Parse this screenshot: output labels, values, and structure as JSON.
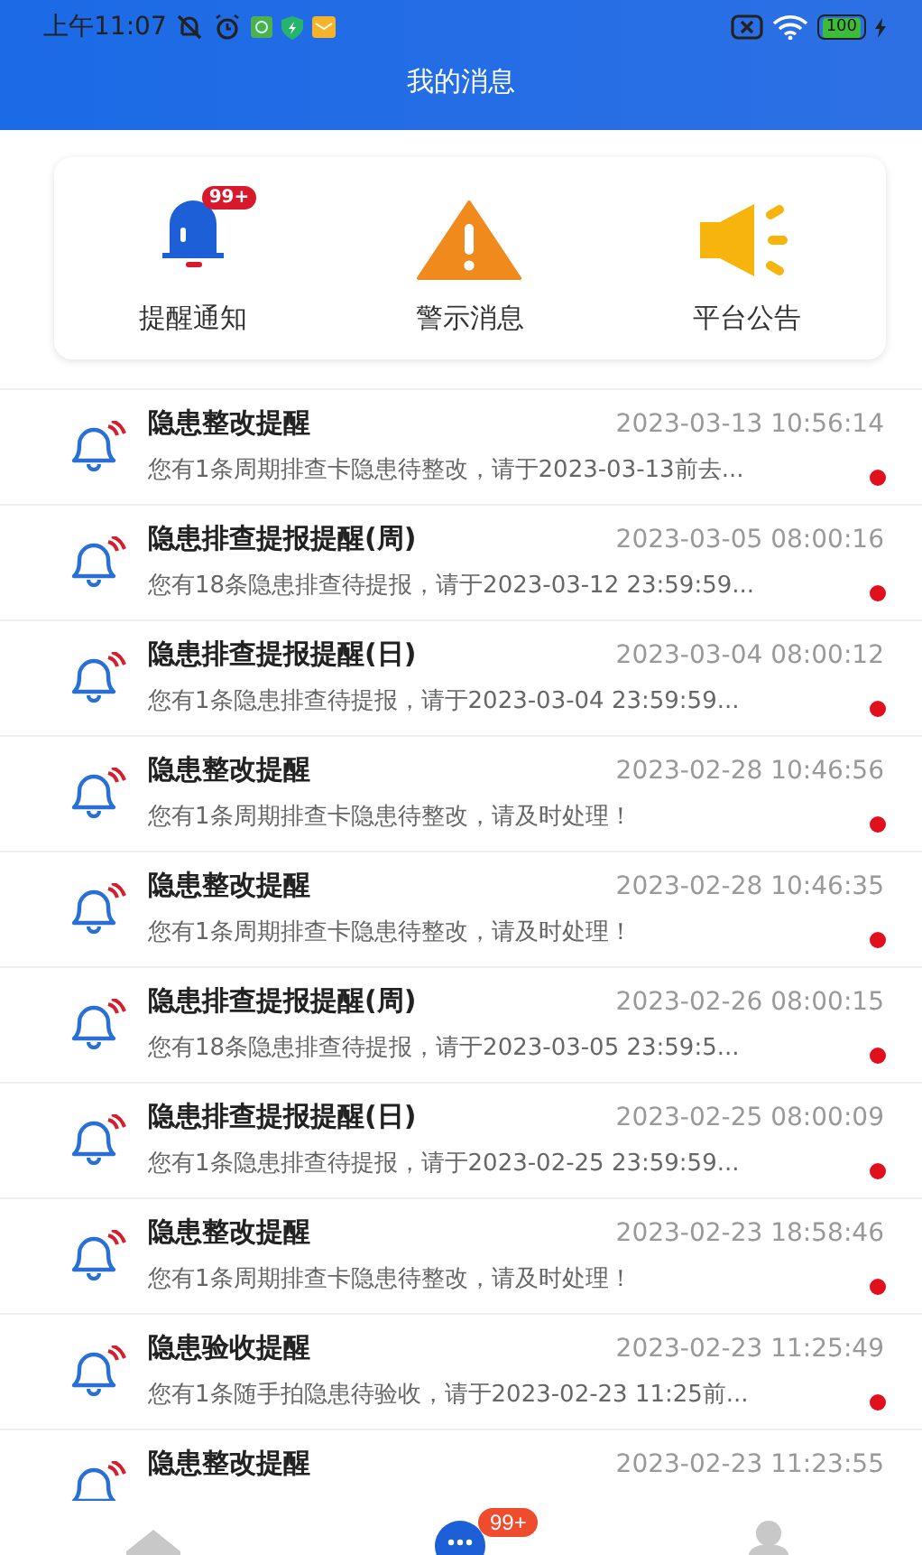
{
  "status_bar": {
    "time": "上午11:07",
    "battery": "100"
  },
  "header": {
    "title": "我的消息"
  },
  "categories": [
    {
      "kind": "bell",
      "label": "提醒通知",
      "badge": "99+"
    },
    {
      "kind": "warning",
      "label": "警示消息"
    },
    {
      "kind": "speaker",
      "label": "平台公告"
    }
  ],
  "messages": [
    {
      "title": "隐患整改提醒",
      "time": "2023-03-13 10:56:14",
      "body": "您有1条周期排查卡隐患待整改，请于2023-03-13前去...",
      "unread": true
    },
    {
      "title": "隐患排查提报提醒(周)",
      "time": "2023-03-05 08:00:16",
      "body": "您有18条隐患排查待提报，请于2023-03-12 23:59:59...",
      "unread": true
    },
    {
      "title": "隐患排查提报提醒(日)",
      "time": "2023-03-04 08:00:12",
      "body": "您有1条隐患排查待提报，请于2023-03-04 23:59:59...",
      "unread": true
    },
    {
      "title": "隐患整改提醒",
      "time": "2023-02-28 10:46:56",
      "body": "您有1条周期排查卡隐患待整改，请及时处理！",
      "unread": true
    },
    {
      "title": "隐患整改提醒",
      "time": "2023-02-28 10:46:35",
      "body": "您有1条周期排查卡隐患待整改，请及时处理！",
      "unread": true
    },
    {
      "title": "隐患排查提报提醒(周)",
      "time": "2023-02-26 08:00:15",
      "body": "您有18条隐患排查待提报，请于2023-03-05 23:59:5...",
      "unread": true
    },
    {
      "title": "隐患排查提报提醒(日)",
      "time": "2023-02-25 08:00:09",
      "body": "您有1条隐患排查待提报，请于2023-02-25 23:59:59...",
      "unread": true
    },
    {
      "title": "隐患整改提醒",
      "time": "2023-02-23 18:58:46",
      "body": "您有1条周期排查卡隐患待整改，请及时处理！",
      "unread": true
    },
    {
      "title": "隐患验收提醒",
      "time": "2023-02-23 11:25:49",
      "body": "您有1条随手拍隐患待验收，请于2023-02-23 11:25前...",
      "unread": true
    },
    {
      "title": "隐患整改提醒",
      "time": "2023-02-23 11:23:55"
    }
  ],
  "bottom_nav": [
    {
      "kind": "home",
      "selected": false
    },
    {
      "kind": "messages",
      "selected": true,
      "badge": "99+"
    },
    {
      "kind": "profile",
      "selected": false
    }
  ]
}
